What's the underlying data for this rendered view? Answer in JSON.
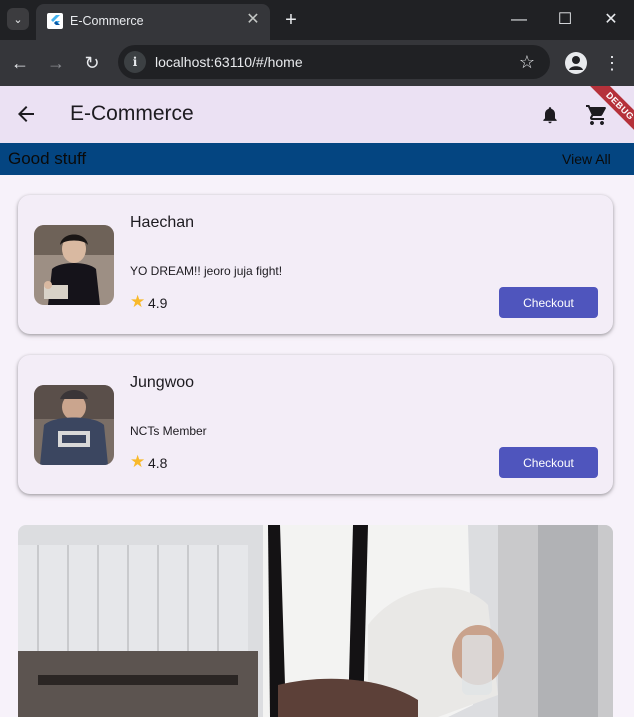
{
  "browser": {
    "tab_title": "E-Commerce",
    "url": "localhost:63110/#/home",
    "new_tab_glyph": "+",
    "close_glyph": "✕",
    "tab_search_glyph": "⌄",
    "minimize_glyph": "—",
    "maximize_glyph": "☐",
    "window_close_glyph": "✕",
    "back_glyph": "←",
    "forward_glyph": "→",
    "reload_glyph": "↻",
    "site_info_glyph": "i",
    "bookmark_glyph": "☆",
    "menu_glyph": "⋮"
  },
  "appbar": {
    "title": "E-Commerce",
    "debug_label": "DEBUG"
  },
  "section": {
    "title": "Good stuff",
    "view_all": "View All"
  },
  "products": [
    {
      "name": "Haechan",
      "description": "YO DREAM!! jeoro juja fight!",
      "rating": "4.9",
      "checkout_label": "Checkout",
      "star_glyph": "★"
    },
    {
      "name": "Jungwoo",
      "description": "NCTs Member",
      "rating": "4.8",
      "checkout_label": "Checkout",
      "star_glyph": "★"
    }
  ],
  "colors": {
    "appbar_bg": "#ebe1f3",
    "section_bg": "#044581",
    "button_bg": "#4f55bd",
    "star": "#f8b92a",
    "debug_banner": "#b5313a"
  }
}
